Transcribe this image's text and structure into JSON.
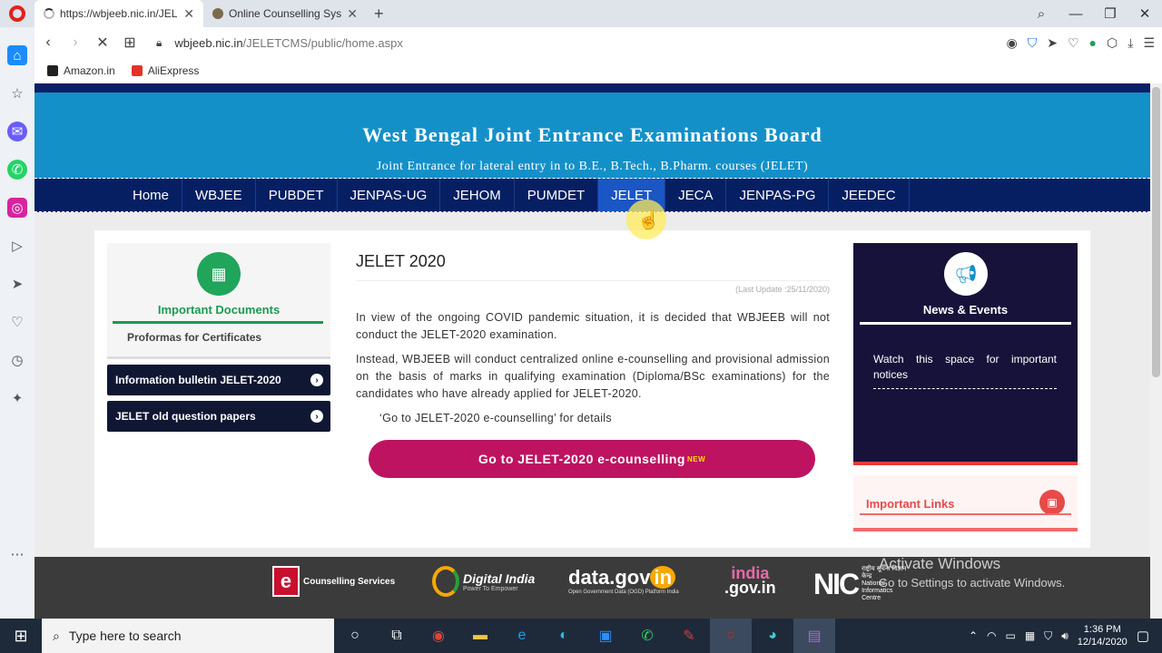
{
  "browser": {
    "tabs": [
      {
        "title": "https://wbjeeb.nic.in/JELET",
        "active": true
      },
      {
        "title": "Online Counselling System",
        "active": false
      }
    ],
    "url_host": "wbjeeb.nic.in",
    "url_path": "/JELETCMS/public/home.aspx",
    "bookmarks": [
      {
        "label": "Amazon.in",
        "icon": "amazon-icon"
      },
      {
        "label": "AliExpress",
        "icon": "aliexpress-icon"
      }
    ]
  },
  "header": {
    "title": "West Bengal Joint Entrance Examinations Board",
    "subtitle": "Joint Entrance for lateral entry in to B.E., B.Tech., B.Pharm. courses (JELET)"
  },
  "nav": {
    "items": [
      "Home",
      "WBJEE",
      "PUBDET",
      "JENPAS-UG",
      "JEHOM",
      "PUMDET",
      "JELET",
      "JECA",
      "JENPAS-PG",
      "JEEDEC"
    ],
    "active": "JELET"
  },
  "left": {
    "docs_title": "Important Documents",
    "docs_link": "Proformas for Certificates",
    "buttons": [
      "Information bulletin JELET-2020",
      "JELET old question papers"
    ]
  },
  "main": {
    "title": "JELET 2020",
    "last_update": "(Last Update :25/11/2020)",
    "para1": "In view of the ongoing COVID pandemic situation, it is decided that WBJEEB will not conduct the JELET-2020 examination.",
    "para2": "Instead, WBJEEB will conduct centralized online e-counselling and provisional admission on the basis of marks in qualifying examination (Diploma/BSc examinations) for the candidates who have already applied for JELET-2020.",
    "para3": "‘Go to JELET-2020 e-counselling’ for details",
    "cta": "Go to JELET-2020 e-counselling",
    "cta_badge": "NEW"
  },
  "right": {
    "news_title": "News & Events",
    "news_body": "Watch this space for important notices",
    "links_title": "Important Links"
  },
  "footer": {
    "ecounselling": "Counselling Services",
    "digital_india": "Digital India",
    "digital_india_sub": "Power To Empower",
    "datagov": "data.gov",
    "datagov_in": "in",
    "datagov_sub": "Open Government Data (OGD) Platform India",
    "indiagov_1": "india",
    "indiagov_2": ".gov.in",
    "nic": "NIC",
    "nic_sub": "National Informatics Centre",
    "nic_hindi": "राष्ट्रीय सूचना विज्ञान केन्द्र"
  },
  "watermark": {
    "line1": "Activate Windows",
    "line2": "Go to Settings to activate Windows."
  },
  "taskbar": {
    "search_placeholder": "Type here to search",
    "time": "1:36 PM",
    "date": "12/14/2020"
  },
  "colors": {
    "header_blue": "#1490c8",
    "nav_navy": "#061f63",
    "cta_magenta": "#be1360",
    "docs_green": "#1c9a50",
    "links_red": "#e84a4a"
  }
}
